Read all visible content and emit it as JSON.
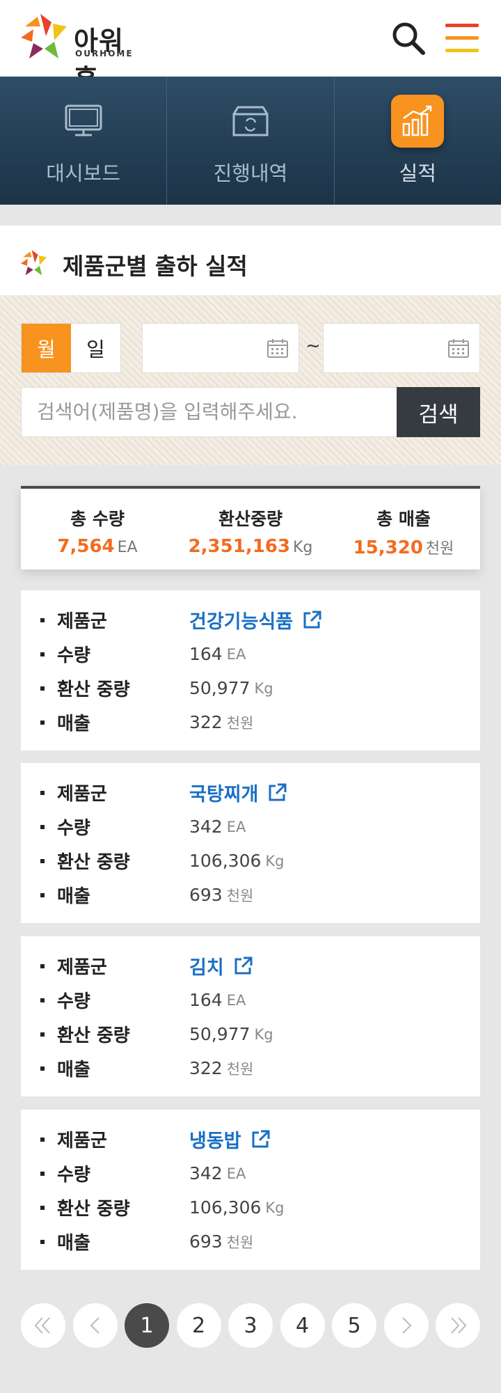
{
  "brand": {
    "name": "아워홈",
    "sub": "OURHOME"
  },
  "nav": [
    {
      "label": "대시보드",
      "icon": "monitor-icon"
    },
    {
      "label": "진행내역",
      "icon": "box-refresh-icon"
    },
    {
      "label": "실적",
      "icon": "bar-chart-icon",
      "active": true
    }
  ],
  "section": {
    "title": "제품군별 출하 실적"
  },
  "filter": {
    "toggle_month": "월",
    "toggle_day": "일",
    "active": "월",
    "date_from": "",
    "date_to": "",
    "tilde": "~",
    "search_placeholder": "검색어(제품명)을 입력해주세요.",
    "search_button": "검색"
  },
  "summary": [
    {
      "label": "총 수량",
      "value": "7,564",
      "unit": "EA"
    },
    {
      "label": "환산중량",
      "value": "2,351,163",
      "unit": "Kg"
    },
    {
      "label": "총 매출",
      "value": "15,320",
      "unit": "천원"
    }
  ],
  "labels": {
    "group": "제품군",
    "qty": "수량",
    "weight": "환산 중량",
    "sales": "매출"
  },
  "cards": [
    {
      "group": "건강기능식품",
      "qty": "164",
      "qty_unit": "EA",
      "weight": "50,977",
      "weight_unit": "Kg",
      "sales": "322",
      "sales_unit": "천원"
    },
    {
      "group": "국탕찌개",
      "qty": "342",
      "qty_unit": "EA",
      "weight": "106,306",
      "weight_unit": "Kg",
      "sales": "693",
      "sales_unit": "천원"
    },
    {
      "group": "김치",
      "qty": "164",
      "qty_unit": "EA",
      "weight": "50,977",
      "weight_unit": "Kg",
      "sales": "322",
      "sales_unit": "천원"
    },
    {
      "group": "냉동밥",
      "qty": "342",
      "qty_unit": "EA",
      "weight": "106,306",
      "weight_unit": "Kg",
      "sales": "693",
      "sales_unit": "천원"
    }
  ],
  "pagination": {
    "pages": [
      "1",
      "2",
      "3",
      "4",
      "5"
    ],
    "current": "1"
  },
  "colors": {
    "accent": "#f7931e",
    "value_orange": "#f26c21",
    "link_blue": "#1a6fc4",
    "nav_bg": "#1c3347"
  }
}
